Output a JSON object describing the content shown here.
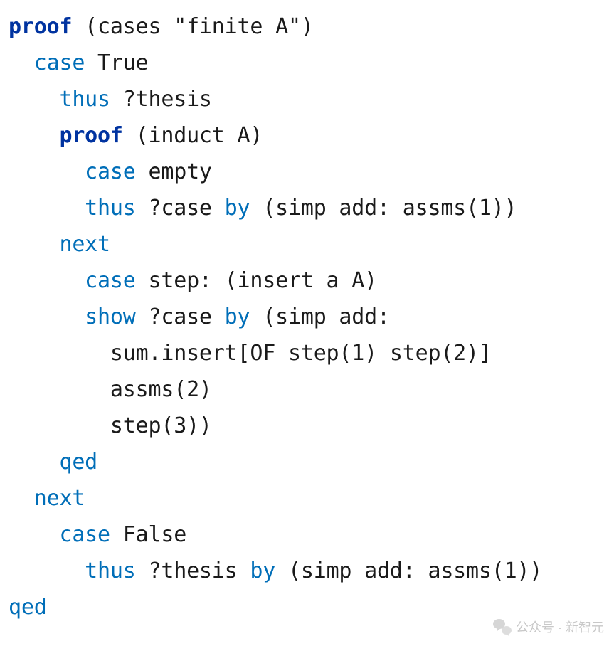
{
  "code": {
    "lines": [
      {
        "indent": 0,
        "tokens": [
          {
            "t": "bold-blue",
            "v": "proof"
          },
          {
            "t": "",
            "v": " (cases \"finite A\")"
          }
        ]
      },
      {
        "indent": 1,
        "tokens": [
          {
            "t": "kw",
            "v": "case"
          },
          {
            "t": "",
            "v": " True"
          }
        ]
      },
      {
        "indent": 2,
        "tokens": [
          {
            "t": "kw",
            "v": "thus"
          },
          {
            "t": "",
            "v": " ?thesis"
          }
        ]
      },
      {
        "indent": 2,
        "tokens": [
          {
            "t": "bold-blue",
            "v": "proof"
          },
          {
            "t": "",
            "v": " (induct A)"
          }
        ]
      },
      {
        "indent": 3,
        "tokens": [
          {
            "t": "kw",
            "v": "case"
          },
          {
            "t": "",
            "v": " empty"
          }
        ]
      },
      {
        "indent": 3,
        "tokens": [
          {
            "t": "kw",
            "v": "thus"
          },
          {
            "t": "",
            "v": " ?case "
          },
          {
            "t": "kw",
            "v": "by"
          },
          {
            "t": "",
            "v": " (simp add: assms(1))"
          }
        ]
      },
      {
        "indent": 2,
        "tokens": [
          {
            "t": "kw",
            "v": "next"
          }
        ]
      },
      {
        "indent": 3,
        "tokens": [
          {
            "t": "kw",
            "v": "case"
          },
          {
            "t": "",
            "v": " step: (insert a A)"
          }
        ]
      },
      {
        "indent": 3,
        "tokens": [
          {
            "t": "kw",
            "v": "show"
          },
          {
            "t": "",
            "v": " ?case "
          },
          {
            "t": "kw",
            "v": "by"
          },
          {
            "t": "",
            "v": " (simp add:"
          }
        ]
      },
      {
        "indent": 4,
        "tokens": [
          {
            "t": "",
            "v": "sum.insert[OF step(1) step(2)]"
          }
        ]
      },
      {
        "indent": 4,
        "tokens": [
          {
            "t": "",
            "v": "assms(2)"
          }
        ]
      },
      {
        "indent": 4,
        "tokens": [
          {
            "t": "",
            "v": "step(3))"
          }
        ]
      },
      {
        "indent": 2,
        "tokens": [
          {
            "t": "kw",
            "v": "qed"
          }
        ]
      },
      {
        "indent": 1,
        "tokens": [
          {
            "t": "kw",
            "v": "next"
          }
        ]
      },
      {
        "indent": 2,
        "tokens": [
          {
            "t": "kw",
            "v": "case"
          },
          {
            "t": "",
            "v": " False"
          }
        ]
      },
      {
        "indent": 3,
        "tokens": [
          {
            "t": "kw",
            "v": "thus"
          },
          {
            "t": "",
            "v": " ?thesis "
          },
          {
            "t": "kw",
            "v": "by"
          },
          {
            "t": "",
            "v": " (simp add: assms(1))"
          }
        ]
      },
      {
        "indent": 0,
        "tokens": [
          {
            "t": "kw",
            "v": "qed"
          }
        ]
      }
    ],
    "indent_unit": "  "
  },
  "watermark": {
    "text": "公众号 · 新智元"
  }
}
